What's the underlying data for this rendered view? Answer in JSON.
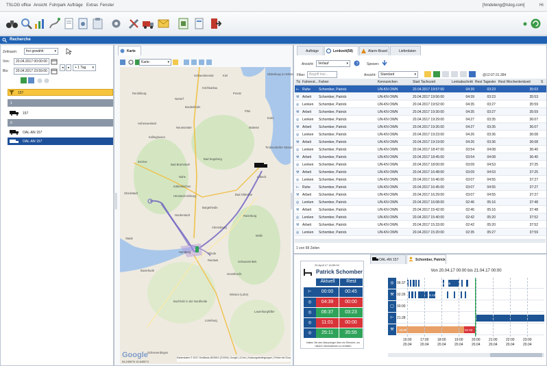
{
  "app": {
    "title": "TSLOG office",
    "user": "[hmdeleng@tslog.com]",
    "help": "Hi"
  },
  "menu": [
    "Ansicht",
    "Fuhrpark",
    "Aufträge",
    "Extras",
    "Fenster"
  ],
  "toolbar_icons": [
    "binoculars-icon",
    "search-icon",
    "chart-icon",
    "route-icon",
    "document-icon",
    "report-icon",
    "clipboard-icon",
    "settings-icon",
    "tools-icon",
    "truck-tools-icon",
    "envelope-icon",
    "export-icon",
    "logout-icon"
  ],
  "window_title": "Recherche",
  "left": {
    "zeitraum_label": "Zeitraum:",
    "zeitraum_value": "frei gewählt",
    "von_label": "Von:",
    "von_value": "20.04.2017 00:00:00",
    "bis_label": "Bis:",
    "bis_value": "20.04.2017 23:59:00",
    "step_value": "+ 1 Tag",
    "search_tag": "157",
    "tree": [
      {
        "label": "1",
        "type": "group"
      },
      {
        "label": "157",
        "type": "vehicle"
      },
      {
        "label": "0",
        "type": "group"
      },
      {
        "label": "OAL-AN 157",
        "type": "vehicle"
      },
      {
        "label": "OAL-AN 157",
        "type": "driver",
        "selected": true
      }
    ]
  },
  "map": {
    "tab": "Karte",
    "mode": "Karte",
    "places": [
      "Schwentinental",
      "Kiel",
      "Kirchbarkau",
      "Preetz",
      "Plön",
      "Oldenburg in Holstein",
      "Rendsburg",
      "Nortorf",
      "Bordesholm",
      "Malente",
      "Hohenwestedt",
      "Neumünster",
      "Eutin",
      "Bad Segeberg",
      "Timmendorfer Strand",
      "Itzehoe",
      "Kellinghusen",
      "Bad Bramstedt",
      "Lübeck",
      "Nahe",
      "Kaltenkirchen",
      "Bad Oldesloe",
      "Glückstadt",
      "Henstedt-Ulzburg",
      "Norderstedt",
      "Bargteheide",
      "Ratzeburg",
      "Ahrensburg",
      "Stade",
      "Hamburg",
      "Mölln",
      "Glinde",
      "Reinbek",
      "Schwarzenbek",
      "Buxtehude",
      "Geesthacht",
      "Buchholz in der Nordheide",
      "Winsen (Luhe)",
      "Lüneburg",
      "Lauenburg/Elbe",
      "Schneverdingen"
    ],
    "attribution": "Kartendaten © 2017 GeoBasis-DE/BKG (©2009), Google | 10 km | Nutzungsbedingungen | Fehler bei Google Maps melden",
    "coords": "54,2456°N 10,6455°O",
    "google": "Google"
  },
  "right": {
    "tabs": [
      "Aufträge",
      "Lenkzeit(58)",
      "Alarm-Board",
      "Lieferdaten"
    ],
    "ansicht_label": "Ansicht:",
    "ansicht_value": "Verlauf",
    "spesen_label": "Spesen:",
    "filter_label": "Filter:",
    "filter_placeholder": "Begriff hier...",
    "ansicht2_label": "Ansicht:",
    "ansicht2_value": "Standard",
    "timestamp": "@12:07:31.384",
    "columns": [
      "Tä",
      "Fahrerst...",
      "Fahrer",
      "Kennzeichen",
      "Start Tachozeit",
      "Lenkabschnitt",
      "Rest Tageslen...",
      "Rest Wochenlenkzeit",
      "S"
    ],
    "rows": [
      [
        "Ruhe",
        "Schomber, Patrick",
        "UN-KN OWN",
        "20.04.2017 19:57:00",
        "04:39",
        "03:23",
        "35:03"
      ],
      [
        "Arbeit",
        "Schomber, Patrick",
        "UN-KN OWN",
        "20.04.2017 19:56:00",
        "04:39",
        "03:23",
        "35:53"
      ],
      [
        "Lenken",
        "Schomber, Patrick",
        "UN-KN OWN",
        "20.04.2017 19:52:00",
        "04:35",
        "03:27",
        "35:59"
      ],
      [
        "Arbeit",
        "Schomber, Patrick",
        "UN-KN OWN",
        "20.04.2017 19:30:00",
        "04:35",
        "03:27",
        "35:59"
      ],
      [
        "Lenken",
        "Schomber, Patrick",
        "UN-KN OWN",
        "20.04.2017 19:29:00",
        "04:27",
        "03:35",
        "36:07"
      ],
      [
        "Arbeit",
        "Schomber, Patrick",
        "UN-KN OWN",
        "20.04.2017 19:26:00",
        "04:27",
        "03:35",
        "36:07"
      ],
      [
        "Lenken",
        "Schomber, Patrick",
        "UN-KN OWN",
        "20.04.2017 19:23:00",
        "04:26",
        "03:36",
        "36:08"
      ],
      [
        "Arbeit",
        "Schomber, Patrick",
        "UN-KN OWN",
        "20.04.2017 19:19:00",
        "04:26",
        "03:36",
        "36:08"
      ],
      [
        "Lenken",
        "Schomber, Patrick",
        "UN-KN OWN",
        "20.04.2017 18:47:00",
        "03:54",
        "04:08",
        "36:40"
      ],
      [
        "Arbeit",
        "Schomber, Patrick",
        "UN-KN OWN",
        "20.04.2017 18:45:00",
        "03:54",
        "04:08",
        "36:40"
      ],
      [
        "Lenken",
        "Schomber, Patrick",
        "UN-KN OWN",
        "20.04.2017 18:00:00",
        "03:09",
        "04:53",
        "37:25"
      ],
      [
        "Arbeit",
        "Schomber, Patrick",
        "UN-KN OWN",
        "20.04.2017 16:48:00",
        "03:09",
        "04:53",
        "37:25"
      ],
      [
        "Lenken",
        "Schomber, Patrick",
        "UN-KN OWN",
        "20.04.2017 16:46:00",
        "03:07",
        "04:55",
        "37:27"
      ],
      [
        "Ruhe",
        "Schomber, Patrick",
        "UN-KN OWN",
        "20.04.2017 16:45:00",
        "03:07",
        "04:55",
        "37:27"
      ],
      [
        "Arbeit",
        "Schomber, Patrick",
        "UN-KN OWN",
        "20.04.2017 16:29:00",
        "03:07",
        "04:55",
        "37:27"
      ],
      [
        "Lenken",
        "Schomber, Patrick",
        "UN-KN OWN",
        "20.04.2017 16:08:00",
        "02:46",
        "05:16",
        "37:48"
      ],
      [
        "Arbeit",
        "Schomber, Patrick",
        "UN-KN OWN",
        "20.04.2017 15:42:00",
        "02:46",
        "05:16",
        "37:48"
      ],
      [
        "Lenken",
        "Schomber, Patrick",
        "UN-KN OWN",
        "20.04.2017 15:40:00",
        "02:42",
        "05:20",
        "37:52"
      ],
      [
        "Arbeit",
        "Schomber, Patrick",
        "UN-KN OWN",
        "20.04.2017 15:33:00",
        "02:42",
        "05:20",
        "37:52"
      ],
      [
        "Lenken",
        "Schomber, Patrick",
        "UN-KN OWN",
        "20.04.2017 15:20:00",
        "02:35",
        "05:27",
        "37:59"
      ]
    ],
    "row_count": "1 von 58 Zeilen"
  },
  "bottom": {
    "tabs": [
      "OAL-AN 157",
      "Schomber, Patrick"
    ],
    "card_date": "20.April 17 16:59:00",
    "driver_name": "Patrick Schomber",
    "col_aktuell": "Aktuell",
    "col_rest": "Rest",
    "status": [
      {
        "a": "00:00",
        "r": "00:45",
        "ac": "#1c5494",
        "rc": "#1c5494"
      },
      {
        "a": "04:39",
        "r": "00:00",
        "ac": "#d8343a",
        "rc": "#d8343a"
      },
      {
        "a": "06:37",
        "r": "03:23",
        "ac": "#2fa35a",
        "rc": "#2fa35a"
      },
      {
        "a": "11:01",
        "r": "00:00",
        "ac": "#d8343a",
        "rc": "#d8343a"
      },
      {
        "a": "25:11",
        "r": "35:55",
        "ac": "#2fa35a",
        "rc": "#2fa35a"
      }
    ],
    "card_hint": "Halten Sie den Mauszeiger über ein Element, um nähere Informationen zu erhalten",
    "timeline_title": "Von 20.04.17 00:00 bis 21.04.17 00:00",
    "timeline_rows": [
      {
        "value": "06:37",
        "icon": "clock-icon"
      },
      {
        "value": "02:26",
        "icon": "work-icon"
      },
      {
        "value": "00:00",
        "icon": "standby-icon"
      },
      {
        "value": "21:28",
        "icon": "rest-icon"
      },
      {
        "value": "89:10",
        "icon": "tools-icon"
      }
    ],
    "bar_labels": [
      "00:45",
      "01:12",
      "16:49",
      "01:03"
    ],
    "ticks": [
      [
        "16:00",
        "20.04"
      ],
      [
        "17:00",
        "20.04"
      ],
      [
        "18:00",
        "20.04"
      ],
      [
        "19:00",
        "20.04"
      ],
      [
        "20:00",
        "20.04"
      ],
      [
        "21:00",
        "20.04"
      ],
      [
        "22:00",
        "20.04"
      ],
      [
        "23:00",
        "20.04"
      ]
    ]
  }
}
